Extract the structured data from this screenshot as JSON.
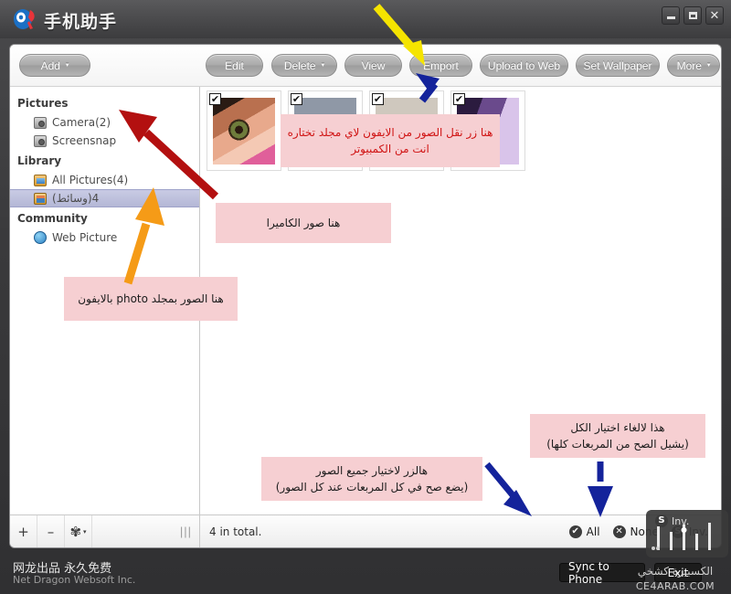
{
  "window": {
    "title": "手机助手",
    "logo_icon": "assistant-logo-icon",
    "minimize_label": "–",
    "maximize_label": "▢",
    "close_label": "✕"
  },
  "toolbar": {
    "buttons": [
      {
        "label": "Add",
        "caret": "▾",
        "name": "add-button"
      },
      {
        "label": "Edit",
        "caret": "",
        "name": "edit-button"
      },
      {
        "label": "Delete",
        "caret": "▾",
        "name": "delete-button"
      },
      {
        "label": "View",
        "caret": "",
        "name": "view-button"
      },
      {
        "label": "Emport",
        "caret": "",
        "name": "emport-button"
      },
      {
        "label": "Upload to Web",
        "caret": "",
        "name": "upload-to-web-button"
      },
      {
        "label": "Set Wallpaper",
        "caret": "",
        "name": "set-wallpaper-button"
      },
      {
        "label": "More",
        "caret": "▾",
        "name": "more-button"
      }
    ]
  },
  "sidebar": {
    "groups": [
      {
        "title": "Pictures",
        "items": [
          {
            "label": "Camera(2)",
            "icon": "camera-icon",
            "selected": false
          },
          {
            "label": "Screensnap",
            "icon": "camera-icon",
            "selected": false
          }
        ]
      },
      {
        "title": "Library",
        "items": [
          {
            "label": "All Pictures(4)",
            "icon": "pictures-folder-icon",
            "selected": false
          },
          {
            "label": "(وسائط)4",
            "icon": "media-folder-icon",
            "selected": true
          }
        ]
      },
      {
        "title": "Community",
        "items": [
          {
            "label": "Web Picture",
            "icon": "globe-icon",
            "selected": false
          }
        ]
      }
    ]
  },
  "content": {
    "thumbnails": [
      {
        "name": "thumbnail-eye",
        "checked": true,
        "check_glyph": "✔",
        "swatch": "pic-eye"
      },
      {
        "name": "thumbnail-gray",
        "checked": true,
        "check_glyph": "✔",
        "swatch": "pic-gray"
      },
      {
        "name": "thumbnail-doc",
        "checked": true,
        "check_glyph": "✔",
        "swatch": "pic-doc"
      },
      {
        "name": "thumbnail-purple",
        "checked": true,
        "check_glyph": "✔",
        "swatch": "pic-purple"
      }
    ]
  },
  "statusbar": {
    "add_label": "+",
    "remove_label": "–",
    "settings_label": "✾",
    "settings_caret": "▾",
    "grip_label": "|||",
    "total_text": "4 in total.",
    "select_all_label": "All",
    "select_all_glyph": "✔",
    "select_none_label": "None",
    "select_none_glyph": "✕",
    "invert_label": "Inv.",
    "invert_glyph": "S"
  },
  "footer": {
    "brand_cn": "网龙出品  永久免费",
    "brand_en": "Net Dragon Websoft Inc.",
    "sync_label": "Sync to Phone",
    "exit_label": "Exit"
  },
  "watermark": {
    "signature": "الكسبيرة كشخي",
    "domain": "CE4ARAB.COM"
  },
  "annotations": [
    {
      "name": "annotation-export-button",
      "lines": [
        "هنا زر نقل الصور من الايفون لاي مجلد تختاره",
        "انت من الكمبيوتر"
      ],
      "color": "red"
    },
    {
      "name": "annotation-camera-photos",
      "lines": [
        "هنا صور الكاميرا"
      ],
      "color": "dark"
    },
    {
      "name": "annotation-iphone-photo-folder",
      "lines": [
        "هنا الصور بمجلد photo بالايفون"
      ],
      "color": "dark"
    },
    {
      "name": "annotation-select-all",
      "lines": [
        "هالزر لاختيار جميع الصور",
        "(يضع صح في كل المربعات عند كل الصور)"
      ],
      "color": "dark"
    },
    {
      "name": "annotation-deselect-all",
      "lines": [
        "هذا لالغاء اختيار الكل",
        "(يشيل الصح من المربعات كلها)"
      ],
      "color": "dark"
    }
  ],
  "arrow_colors": {
    "yellow": "#f5e400",
    "blue": "#14239b",
    "red": "#b31010",
    "orange": "#f59b17"
  }
}
